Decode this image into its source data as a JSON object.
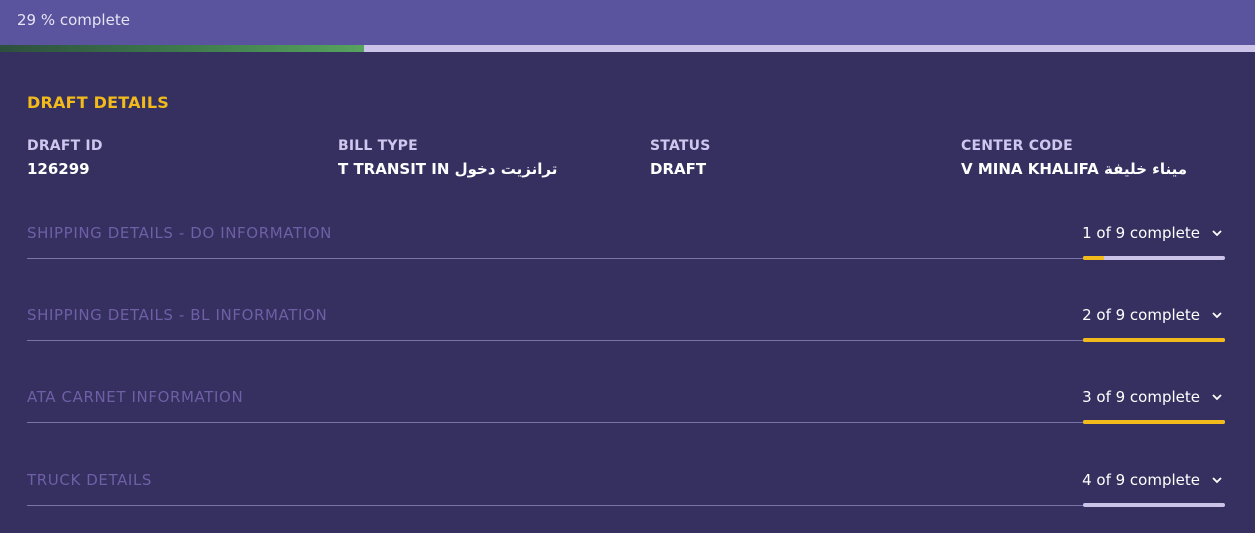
{
  "progress": {
    "label": "29 % complete",
    "fraction": 0.29
  },
  "draft_details": {
    "title": "DRAFT DETAILS",
    "fields": [
      {
        "label": "DRAFT ID",
        "value": "126299"
      },
      {
        "label": "BILL TYPE",
        "value": "T TRANSIT IN ترانزيت دخول"
      },
      {
        "label": "STATUS",
        "value": "DRAFT"
      },
      {
        "label": "CENTER CODE",
        "value": "V MINA KHALIFA ميناء خليفة"
      }
    ]
  },
  "sections": [
    {
      "title": "SHIPPING DETAILS - DO INFORMATION",
      "status": "1 of 9 complete",
      "fraction": 0.15
    },
    {
      "title": "SHIPPING DETAILS - BL INFORMATION",
      "status": "2 of 9 complete",
      "fraction": 1.0
    },
    {
      "title": "ATA CARNET INFORMATION",
      "status": "3 of 9 complete",
      "fraction": 1.0
    },
    {
      "title": "TRUCK DETAILS",
      "status": "4 of 9 complete",
      "fraction": 0.0
    }
  ],
  "colors": {
    "accent": "#f2bb1b",
    "progress_fill": "#57a35f",
    "background": "#35305f",
    "header": "#5a539d"
  },
  "icons": {
    "accordion_toggle": "chevron-down-icon"
  }
}
